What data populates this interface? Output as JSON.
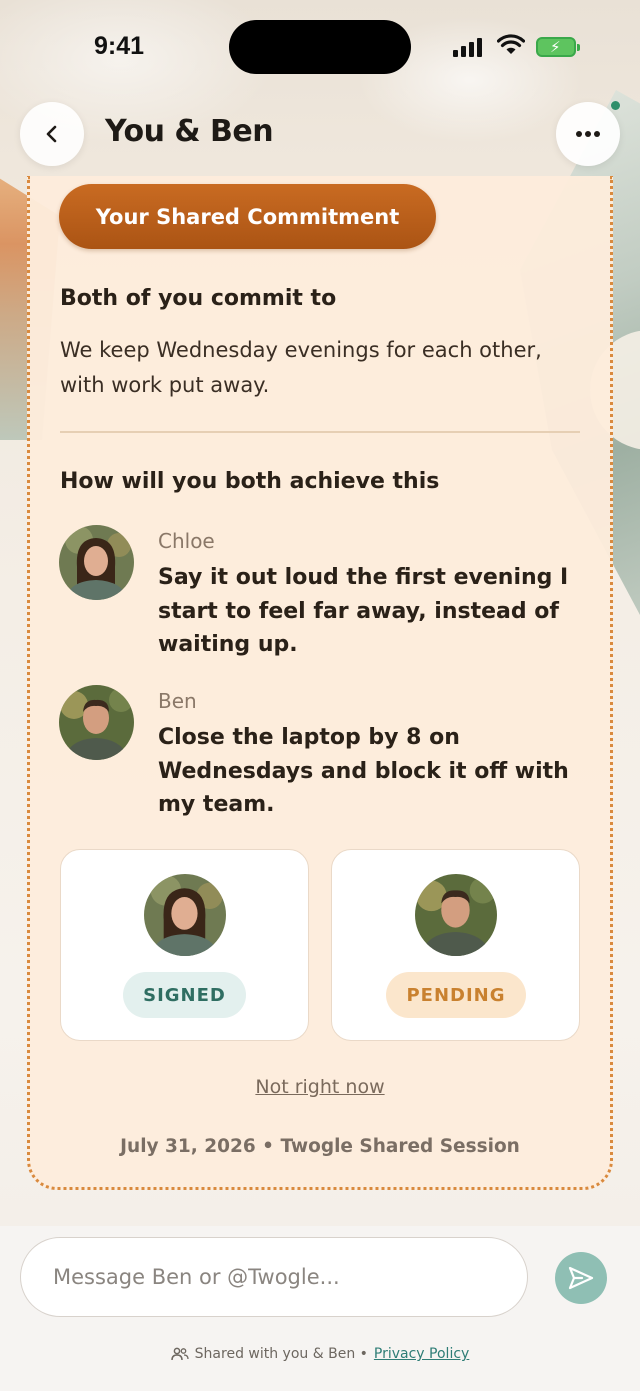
{
  "status_bar": {
    "time": "9:41"
  },
  "header": {
    "title": "You & Ben"
  },
  "card": {
    "pill_label": "Your Shared Commitment",
    "commit_heading": "Both of you commit to",
    "commit_text": "We keep Wednesday evenings for each other, with work put away.",
    "achieve_heading": "How will you both achieve this",
    "people": [
      {
        "name": "Chloe",
        "plan": "Say it out loud the first evening I start to feel far away, instead of waiting up."
      },
      {
        "name": "Ben",
        "plan": "Close the laptop by 8 on Wednesdays and block it off with my team."
      }
    ],
    "signatures": [
      {
        "status": "SIGNED"
      },
      {
        "status": "PENDING"
      }
    ],
    "not_now": "Not right now",
    "session_line": "July 31, 2026 • Twogle Shared Session"
  },
  "composer": {
    "placeholder": "Message Ben or @Twogle..."
  },
  "footer": {
    "shared_text": "Shared with you & Ben •",
    "privacy_link": "Privacy Policy"
  },
  "colors": {
    "accent": "#B85E1A",
    "card_bg": "#FDECDC",
    "signed_text": "#2F6E62",
    "pending_text": "#C9812F",
    "link": "#2E7D76"
  },
  "icons": {
    "back": "chevron-left-icon",
    "more": "ellipsis-icon",
    "send": "send-icon",
    "people": "people-icon"
  }
}
